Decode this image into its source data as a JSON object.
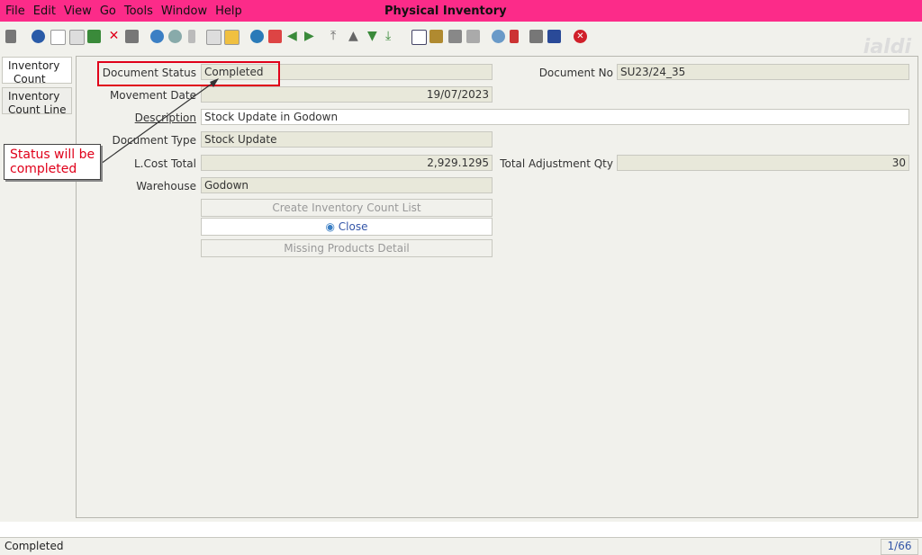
{
  "window": {
    "title": "Physical Inventory"
  },
  "menu": [
    {
      "label": "File"
    },
    {
      "label": "Edit"
    },
    {
      "label": "View"
    },
    {
      "label": "Go"
    },
    {
      "label": "Tools"
    },
    {
      "label": "Window"
    },
    {
      "label": "Help"
    }
  ],
  "watermark": "jaldi",
  "tabs": [
    {
      "label_1": "Inventory",
      "label_2": "Count"
    },
    {
      "label_1": "Inventory",
      "label_2": "Count Line"
    }
  ],
  "form": {
    "document_status_label": "Document Status",
    "document_status_value": "Completed",
    "document_no_label": "Document No",
    "document_no_value": "SU23/24_35",
    "movement_date_label": "Movement Date",
    "movement_date_value": "19/07/2023",
    "description_label": "Description",
    "description_value": "Stock Update in Godown",
    "document_type_label": "Document Type",
    "document_type_value": "Stock Update",
    "lcost_total_label": "L.Cost Total",
    "lcost_total_value": "2,929.1295",
    "total_adjustment_label": "Total Adjustment Qty",
    "total_adjustment_value": "30",
    "warehouse_label": "Warehouse",
    "warehouse_value": "Godown"
  },
  "buttons": {
    "create_list": "Create Inventory Count List",
    "close": "Close",
    "missing": "Missing Products Detail"
  },
  "annotation": {
    "line1": "Status will be",
    "line2": "completed"
  },
  "status": {
    "text": "Completed",
    "record": "1/66"
  },
  "colors": {
    "titlebar": "#fc2b89",
    "annotation_red": "#e0001a"
  }
}
